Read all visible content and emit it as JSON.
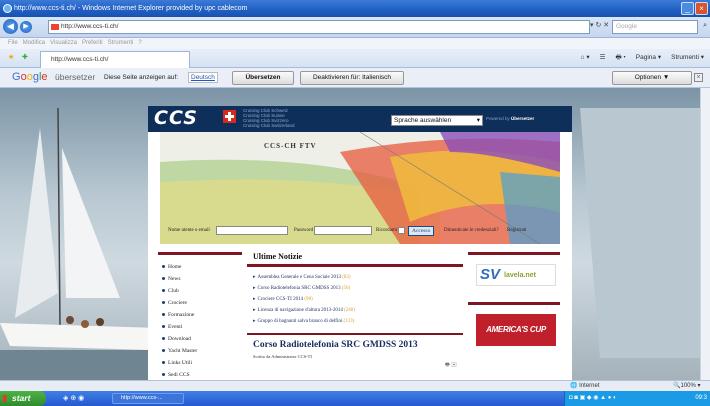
{
  "window": {
    "title": "http://www.ccs-ti.ch/ - Windows Internet Explorer provided by upc cablecom"
  },
  "addressbar": {
    "url": "http://www.ccs-ti.ch/",
    "search_placeholder": "Google"
  },
  "menu": {
    "items": [
      "File",
      "Modifica",
      "Visualizza",
      "Preferiti",
      "Strumenti",
      "?"
    ]
  },
  "tabs": {
    "active_tab": "http://www.ccs-ti.ch/",
    "commands": [
      "Pagina ▾",
      "Strumenti ▾"
    ]
  },
  "translate": {
    "brand_google": "Google",
    "brand_sub": "übersetzer",
    "prompt": "Diese Seite anzeigen auf:",
    "language": "Deutsch",
    "translate_button": "Übersetzen",
    "disable_button": "Deaktivieren für: Italienisch",
    "options_button": "Optionen ▼",
    "close": "×"
  },
  "site": {
    "logo": "CCS",
    "club_names": [
      "Cruising Club Schweiz",
      "Cruising Club Suisse",
      "Cruising Club Svizzero",
      "Cruising Club Switzerland"
    ],
    "language_select": "Sprache auswählen",
    "powered_by": "Powered by",
    "powered_brand": "Übersetzer",
    "banner_title": "CCS-CH    FTV",
    "login": {
      "user_label": "Nome utente o email",
      "password_label": "Password",
      "remember_label": "Ricordami",
      "login_button": "Accesso",
      "forgot_link": "Dimenticate le credenziali?",
      "register_link": "Registrati"
    },
    "nav": [
      "Home",
      "News",
      "Club",
      "Crociere",
      "Formazione",
      "Eventi",
      "Download",
      "Yacht Master",
      "Links Utili",
      "Sedi CCS"
    ],
    "news": {
      "title": "Ultime Notizie",
      "items": [
        {
          "text": "Assemblea Generale e Cena Sociale 2013",
          "count": "(83)"
        },
        {
          "text": "Corso Radiotelefonia SRC GMDSS 2013",
          "count": "(56)"
        },
        {
          "text": "Crociere CCS-TI 2014",
          "count": "(98)"
        },
        {
          "text": "Licenza di navigazione d'altura 2013-2014",
          "count": "(240)"
        },
        {
          "text": "Gruppo di bagnanti salva branco di delfini",
          "count": "(133)"
        }
      ]
    },
    "article": {
      "title": "Corso Radiotelefonia SRC GMDSS 2013",
      "author": "Scritto da Administrator CCS-TI",
      "icons": "🖶 ✉"
    },
    "ads": {
      "sv_logo": "SV",
      "sv_text": "lavela.net",
      "americas_cup": "AMERICA'S CUP"
    }
  },
  "statusbar": {
    "zone": "Internet",
    "zoom": "100%"
  },
  "taskbar": {
    "start": "start",
    "task": "http://www.ccs-...",
    "lang": "DE",
    "clock": "09:3"
  }
}
